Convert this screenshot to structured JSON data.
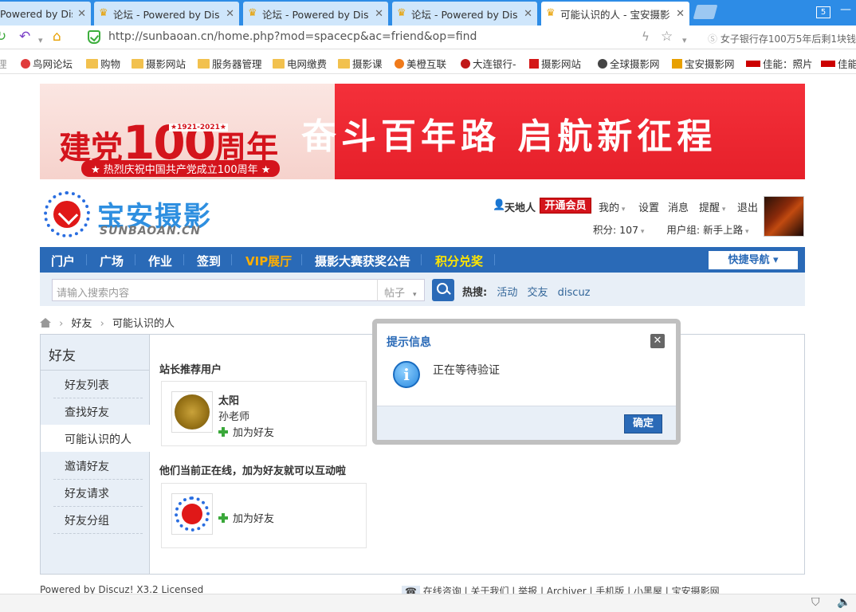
{
  "browser": {
    "tabs": [
      {
        "label": "Powered by Dis"
      },
      {
        "label": "论坛 - Powered by Dis"
      },
      {
        "label": "论坛 - Powered by Dis"
      },
      {
        "label": "论坛 - Powered by Dis"
      },
      {
        "label": "可能认识的人 - 宝安摄影"
      }
    ],
    "tab_count": "5",
    "url": "http://sunbaoan.cn/home.php?mod=spacecp&ac=friend&op=find",
    "search_text": "女子银行存100万5年后剩1块钱",
    "bookmarks": [
      {
        "label": "鸟网论坛"
      },
      {
        "label": "购物"
      },
      {
        "label": "摄影网站"
      },
      {
        "label": "服务器管理"
      },
      {
        "label": "电网缴费"
      },
      {
        "label": "摄影课"
      },
      {
        "label": "美橙互联"
      },
      {
        "label": "大连银行-"
      },
      {
        "label": "摄影网站"
      },
      {
        "label": "全球摄影网"
      },
      {
        "label": "宝安摄影网"
      },
      {
        "label": "佳能：照片"
      },
      {
        "label": "佳能"
      }
    ]
  },
  "banner": {
    "title_pre": "建党",
    "title_num": "100",
    "title_post": "周年",
    "years": "★1921-2021★",
    "subtitle": "★ 热烈庆祝中国共产党成立100周年 ★",
    "slogan": "奋斗百年路 启航新征程"
  },
  "site": {
    "name": "宝安摄影",
    "name_en": "SUNBAOAN.CN"
  },
  "user": {
    "name": "天地人",
    "vip": "开通会员",
    "menu": [
      "我的",
      "设置",
      "消息",
      "提醒",
      "退出"
    ],
    "points": "积分: 107",
    "group": "用户组: 新手上路"
  },
  "nav": {
    "items": [
      "门户",
      "广场",
      "作业",
      "签到",
      "VIP展厅",
      "摄影大赛获奖公告",
      "积分兑奖"
    ],
    "quick": "快捷导航 ▾"
  },
  "search": {
    "placeholder": "请输入搜索内容",
    "type": "帖子",
    "hot_label": "热搜:",
    "hot": [
      "活动",
      "交友",
      "discuz"
    ]
  },
  "breadcrumb": [
    "好友",
    "可能认识的人"
  ],
  "sidebar": {
    "title": "好友",
    "items": [
      "好友列表",
      "查找好友",
      "可能认识的人",
      "邀请好友",
      "好友请求",
      "好友分组"
    ],
    "active_index": 2
  },
  "main": {
    "section1": "站长推荐用户",
    "rec_user": {
      "name": "太阳",
      "note": "孙老师",
      "add": "加为好友"
    },
    "section2": "他们当前正在线，加为好友就可以互动啦",
    "online_user": {
      "add": "加为好友"
    }
  },
  "footer": {
    "left": "Powered by Discuz! X3.2 Licensed",
    "right": "在线咨询 | 关于我们 | 举报 | Archiver | 手机版 | 小黑屋 | 宝安摄影网"
  },
  "dialog": {
    "title": "提示信息",
    "message": "正在等待验证",
    "ok": "确定"
  }
}
